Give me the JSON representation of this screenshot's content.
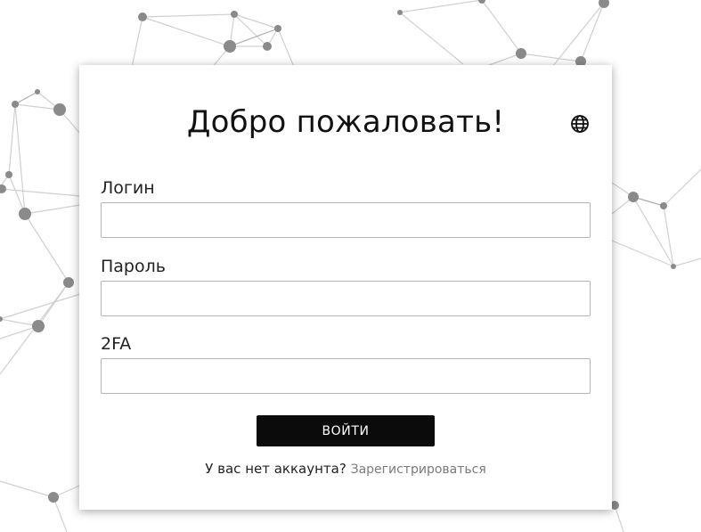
{
  "card": {
    "title": "Добро пожаловать!",
    "language_icon": "globe-icon"
  },
  "fields": {
    "login_label": "Логин",
    "login_value": "",
    "password_label": "Пароль",
    "password_value": "",
    "twofa_label": "2FA",
    "twofa_value": ""
  },
  "actions": {
    "login_button": "ВОЙТИ",
    "no_account_text": "У вас нет аккаунта?",
    "register_link": "Зарегистрироваться"
  },
  "colors": {
    "button_bg": "#0b0b0b",
    "link": "#7a7a7a",
    "network_nodes": "#8a8a8a"
  }
}
